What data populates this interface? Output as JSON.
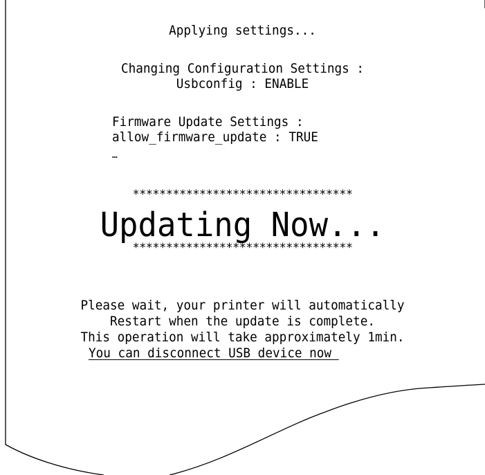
{
  "receipt": {
    "applying": "Applying settings...",
    "changing_config": "Changing Configuration Settings :",
    "usbconfig": "Usbconfig : ENABLE",
    "firmware_settings": "Firmware Update Settings :",
    "allow_firmware": "allow_firmware_update : TRUE",
    "ellipsis": "…",
    "stars_top": "*********************************",
    "updating": "Updating Now...",
    "stars_bottom": "*********************************",
    "wait_line1": "Please wait, your printer will automatically",
    "wait_line2": "Restart when the update is complete.",
    "wait_line3": "This operation will take approximately 1min.",
    "disconnect": "You can disconnect USB device now "
  }
}
